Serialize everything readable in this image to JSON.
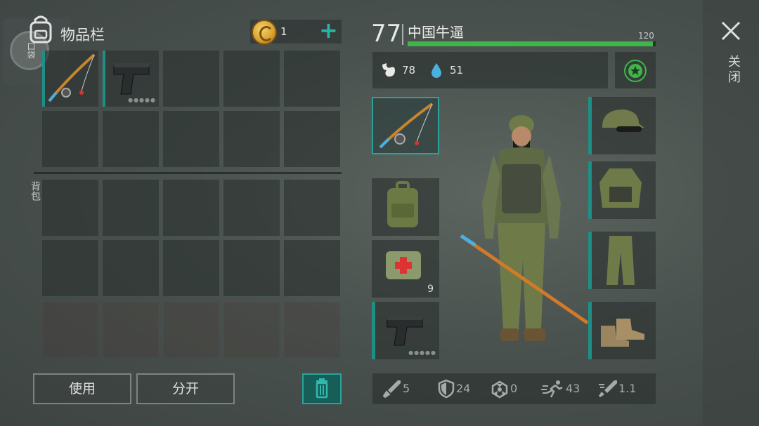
{
  "inventory": {
    "title": "物品栏",
    "coins": "1",
    "add_symbol": "+",
    "backpack_button_label": "口袋",
    "backpack_section_label": "背包",
    "buttons": {
      "use": "使用",
      "split": "分开"
    }
  },
  "character": {
    "level": "77",
    "name": "中国牛逼",
    "hp_max": "120",
    "hp_fraction": 0.99,
    "food": "78",
    "water": "51",
    "medkit_count": "9"
  },
  "bottom_stats": {
    "damage": "5",
    "defense": "24",
    "radiation": "0",
    "speed": "43",
    "attack_speed": "1.1"
  },
  "close": {
    "label": "关闭"
  },
  "icons": {
    "backpack": "backpack-icon",
    "coin": "coin-icon",
    "fishing_rod": "fishing-rod-icon",
    "pistol": "pistol-icon",
    "stomach": "stomach-icon",
    "water_drop": "water-drop-icon",
    "star": "star-icon",
    "trash": "trash-icon",
    "close": "close-icon"
  },
  "colors": {
    "accent": "#27b6a4",
    "hp": "#3fb54a"
  }
}
